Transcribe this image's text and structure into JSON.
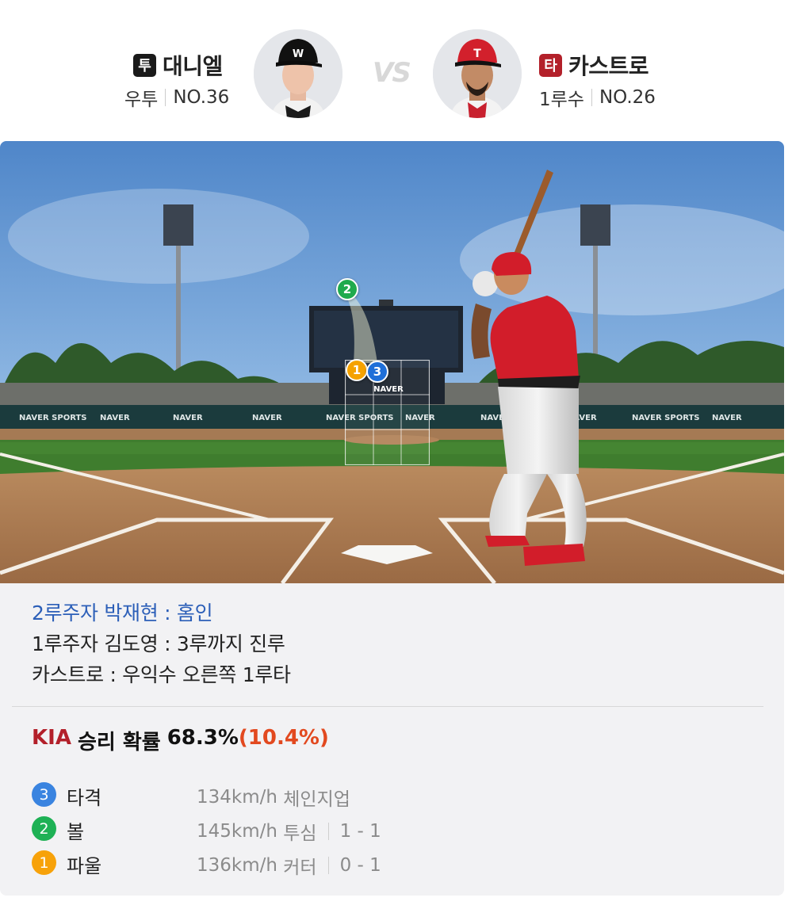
{
  "matchup": {
    "pitcher": {
      "role_badge": "투",
      "name": "대니엘",
      "throws": "우투",
      "number": "NO.36",
      "badge_color": "#1a1a1a"
    },
    "vs_label": "VS",
    "batter": {
      "role_badge": "타",
      "name": "카스트로",
      "position": "1루수",
      "number": "NO.26",
      "badge_color": "#b3202a"
    }
  },
  "field": {
    "scoreboard_text": "NAVER",
    "wall_ads": [
      "NAVER SPORTS",
      "NAVER",
      "NAVER",
      "NAVER",
      "NAVER SPORTS",
      "NAVER",
      "NAVER SPORTS",
      "NAVER",
      "NAVER SPORTS",
      "NAVER"
    ],
    "markers": [
      {
        "num": "2",
        "color": "#1faa4d"
      },
      {
        "num": "1",
        "color": "#f5a200"
      },
      {
        "num": "3",
        "color": "#1f6fd8"
      }
    ]
  },
  "result": {
    "lines": [
      "2루주자 박재현 : 홈인",
      "1루주자 김도영 : 3루까지 진루",
      "카스트로 : 우익수 오른쪽 1루타"
    ],
    "win_probability": {
      "team": "KIA",
      "label": "승리 확률",
      "value": "68.3%",
      "change": "(10.4%)"
    }
  },
  "pitches": [
    {
      "num": "3",
      "result": "타격",
      "speed": "134km/h",
      "type": "체인지업",
      "count": "",
      "color": "#3a84e0"
    },
    {
      "num": "2",
      "result": "볼",
      "speed": "145km/h",
      "type": "투심",
      "count": "1 - 1",
      "color": "#1eb155"
    },
    {
      "num": "1",
      "result": "파울",
      "speed": "136km/h",
      "type": "커터",
      "count": "0 - 1",
      "color": "#f7a20a"
    }
  ]
}
